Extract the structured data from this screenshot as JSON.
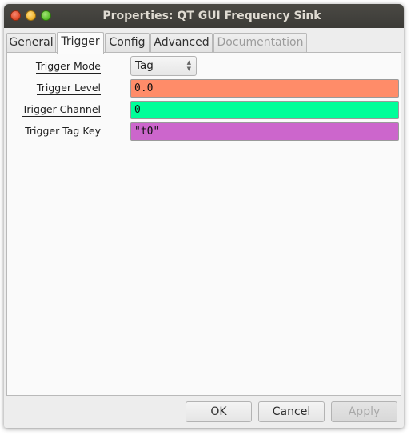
{
  "window": {
    "title": "Properties: QT GUI Frequency Sink"
  },
  "tabs": [
    {
      "label": "General",
      "state": "normal"
    },
    {
      "label": "Trigger",
      "state": "active"
    },
    {
      "label": "Config",
      "state": "normal"
    },
    {
      "label": "Advanced",
      "state": "normal"
    },
    {
      "label": "Documentation",
      "state": "disabled"
    }
  ],
  "trigger": {
    "mode": {
      "label": "Trigger Mode",
      "value": "Tag"
    },
    "level": {
      "label": "Trigger Level",
      "value": "0.0",
      "color": "#ff8c69"
    },
    "channel": {
      "label": "Trigger Channel",
      "value": "0",
      "color": "#00ff99"
    },
    "tag_key": {
      "label": "Trigger Tag Key",
      "value": "\"t0\"",
      "color": "#cc66cc"
    }
  },
  "buttons": {
    "ok": "OK",
    "cancel": "Cancel",
    "apply": "Apply"
  }
}
